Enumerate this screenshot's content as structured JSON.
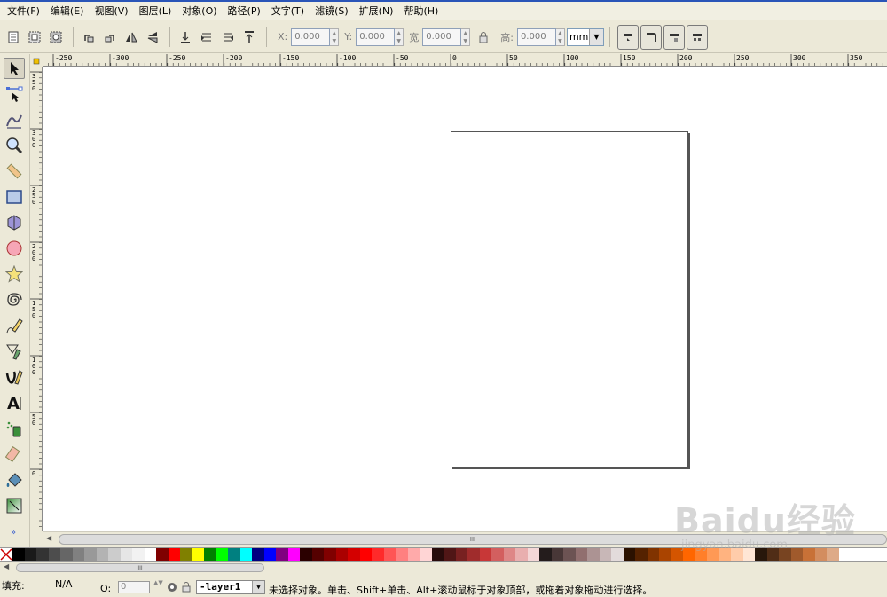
{
  "menu": [
    "文件(F)",
    "编辑(E)",
    "视图(V)",
    "图层(L)",
    "对象(O)",
    "路径(P)",
    "文字(T)",
    "滤镜(S)",
    "扩展(N)",
    "帮助(H)"
  ],
  "toolbar": {
    "x_label": "X:",
    "x_value": "0.000",
    "y_label": "Y:",
    "y_value": "0.000",
    "w_label": "宽",
    "w_value": "0.000",
    "h_label": "高:",
    "h_value": "0.000",
    "unit": "mm"
  },
  "tools": [
    "select-tool",
    "node-tool",
    "tweak-tool",
    "zoom-tool",
    "measure-tool",
    "rect-tool",
    "3dbox-tool",
    "ellipse-tool",
    "star-tool",
    "spiral-tool",
    "pencil-tool",
    "pen-tool",
    "calligraphy-tool",
    "text-tool",
    "spray-tool",
    "eraser-tool",
    "bucket-tool",
    "gradient-tool"
  ],
  "more_tools": "»",
  "ruler_h": [
    "-250",
    "-300",
    "-250",
    "-200",
    "-150",
    "-100",
    "-50",
    "0",
    "50",
    "100",
    "150",
    "200",
    "250",
    "300",
    "350"
  ],
  "ruler_v": [
    "350",
    "300",
    "250",
    "200",
    "150",
    "100",
    "50",
    "0"
  ],
  "scroll_grip": "III",
  "palette": [
    "#000000",
    "#1a1a1a",
    "#333333",
    "#4d4d4d",
    "#666666",
    "#808080",
    "#999999",
    "#b3b3b3",
    "#cccccc",
    "#e6e6e6",
    "#f2f2f2",
    "#ffffff",
    "#800000",
    "#ff0000",
    "#808000",
    "#ffff00",
    "#008000",
    "#00ff00",
    "#008080",
    "#00ffff",
    "#000080",
    "#0000ff",
    "#800080",
    "#ff00ff",
    "#2b0000",
    "#550000",
    "#800000",
    "#aa0000",
    "#d40000",
    "#ff0000",
    "#ff2a2a",
    "#ff5555",
    "#ff8080",
    "#ffaaaa",
    "#ffd5d5",
    "#280b0b",
    "#501616",
    "#782121",
    "#a02c2c",
    "#c83737",
    "#d35f5f",
    "#de8787",
    "#e9afaf",
    "#f4d7d7",
    "#241c1c",
    "#483737",
    "#6c5353",
    "#916f6f",
    "#ac9393",
    "#c8b7b7",
    "#e3dbdb",
    "#2b1100",
    "#552200",
    "#803300",
    "#aa4400",
    "#d45500",
    "#ff6600",
    "#ff7f2a",
    "#ff9955",
    "#ffb380",
    "#ffccaa",
    "#ffe6d5",
    "#28170b",
    "#502d16",
    "#784421",
    "#a05a2c",
    "#c87137",
    "#d38d5f",
    "#deaa87"
  ],
  "status": {
    "fill_label": "填充:",
    "fill_value": "N/A",
    "opacity_label": "O:",
    "opacity_value": "0",
    "layer": "-layer1",
    "message": "未选择对象。单击、Shift+单击、Alt+滚动鼠标于对象顶部，或拖着对象拖动进行选择。"
  },
  "watermark": {
    "logo": "Baidu经验",
    "url": "jingyan.baidu.com"
  }
}
